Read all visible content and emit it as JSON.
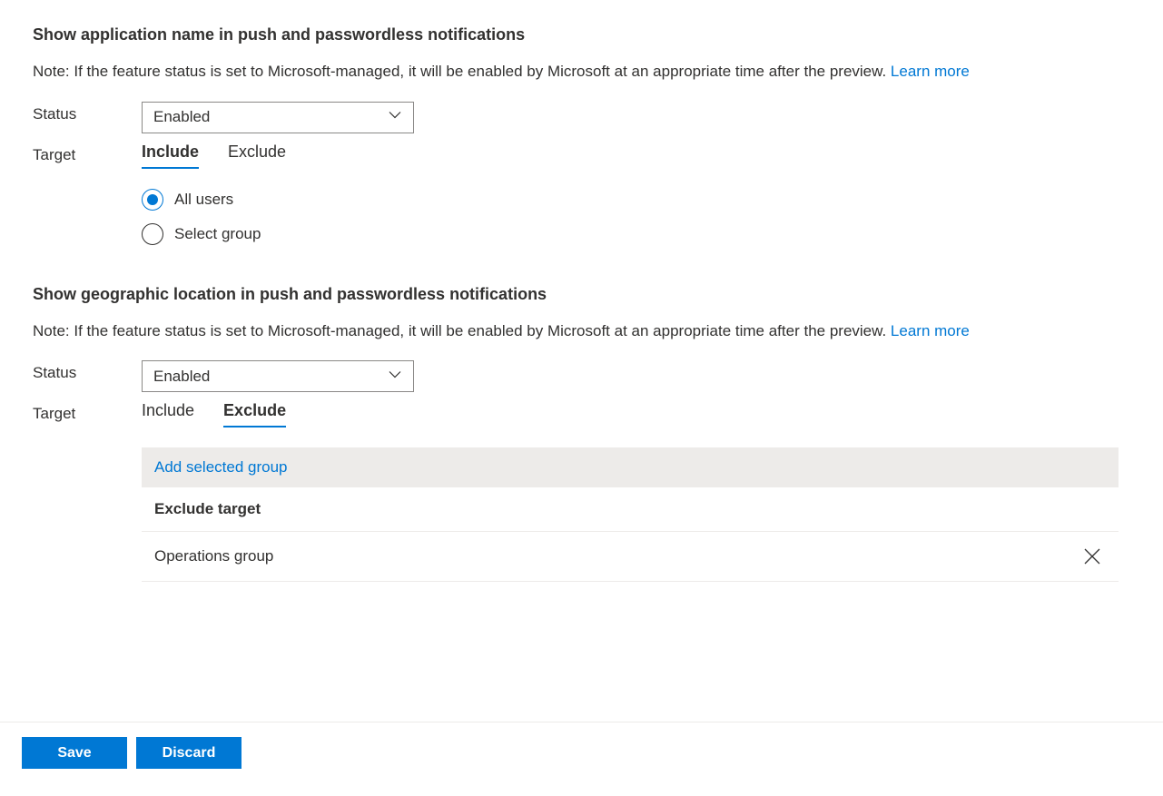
{
  "section1": {
    "heading": "Show application name in push and passwordless notifications",
    "note": "Note: If the feature status is set to Microsoft-managed, it will be enabled by Microsoft at an appropriate time after the preview. ",
    "learn_more": "Learn more",
    "status_label": "Status",
    "status_value": "Enabled",
    "target_label": "Target",
    "tabs": {
      "include": "Include",
      "exclude": "Exclude"
    },
    "radio": {
      "all_users": "All users",
      "select_group": "Select group"
    }
  },
  "section2": {
    "heading": "Show geographic location in push and passwordless notifications",
    "note": "Note: If the feature status is set to Microsoft-managed, it will be enabled by Microsoft at an appropriate time after the preview. ",
    "learn_more": "Learn more",
    "status_label": "Status",
    "status_value": "Enabled",
    "target_label": "Target",
    "tabs": {
      "include": "Include",
      "exclude": "Exclude"
    },
    "add_group": "Add selected group",
    "exclude_header": "Exclude target",
    "exclude_items": [
      {
        "name": "Operations group"
      }
    ]
  },
  "footer": {
    "save": "Save",
    "discard": "Discard"
  }
}
